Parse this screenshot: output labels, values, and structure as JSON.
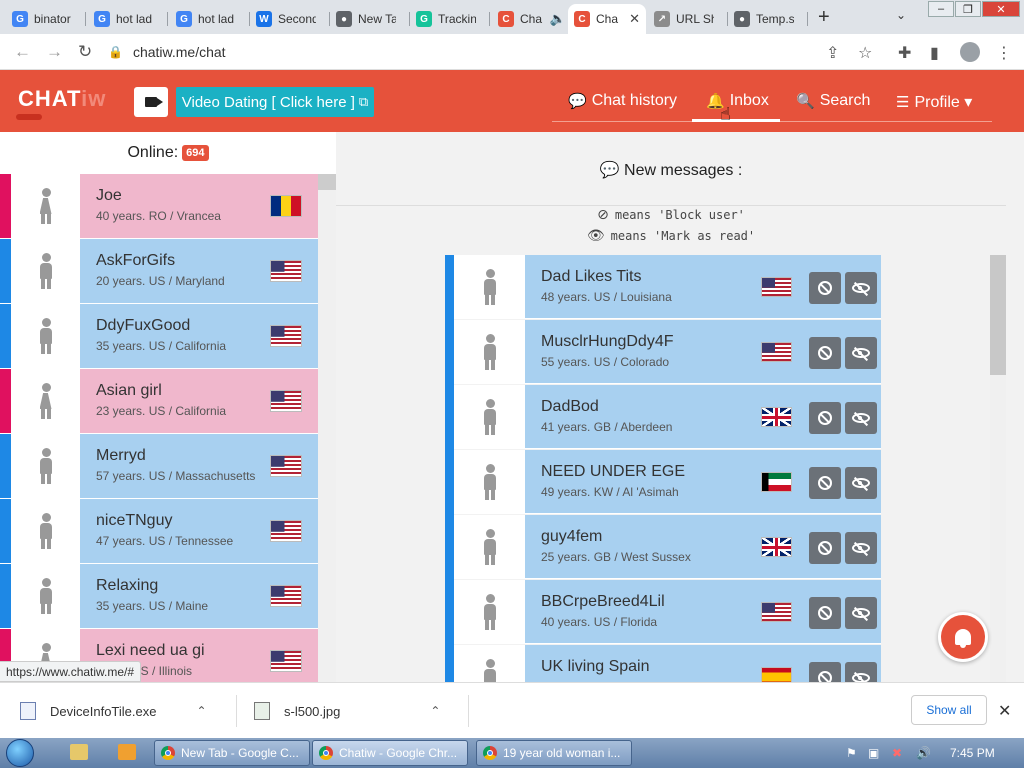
{
  "browser": {
    "tabs": [
      {
        "label": "binator",
        "favicon": "G",
        "color": "#4285f4",
        "active": false
      },
      {
        "label": "hot lad",
        "favicon": "G",
        "color": "#4285f4",
        "active": false
      },
      {
        "label": "hot lad",
        "favicon": "G",
        "color": "#4285f4",
        "active": false
      },
      {
        "label": "Second",
        "favicon": "W",
        "color": "#1a73e8",
        "active": false
      },
      {
        "label": "New Ta",
        "favicon": "●",
        "color": "#5f6368",
        "active": false
      },
      {
        "label": "Trackin",
        "favicon": "G",
        "color": "#15c39a",
        "active": false
      },
      {
        "label": "Cha",
        "favicon": "C",
        "color": "#e6523b",
        "active": false,
        "audio": "🔈"
      },
      {
        "label": "Cha",
        "favicon": "C",
        "color": "#e6523b",
        "active": true,
        "close": "✕"
      },
      {
        "label": "URL Sh",
        "favicon": "↗",
        "color": "#8c8c8c",
        "active": false
      },
      {
        "label": "Temp.s",
        "favicon": "●",
        "color": "#5f6368",
        "active": false
      }
    ],
    "new_tab": "+",
    "tab_menu": "⌄",
    "window_controls": [
      "–",
      "❐",
      "✕"
    ],
    "nav": {
      "back": "←",
      "forward": "→",
      "reload": "↻"
    },
    "lock_icon": "🔒",
    "url": "chatiw.me/chat",
    "toolbar_icons": {
      "share": "⇪",
      "star": "☆",
      "extensions": "✚",
      "sidepanel": "▮",
      "menu": "⋮"
    }
  },
  "header": {
    "logo_main": "CHAT",
    "logo_suffix": "iw",
    "video_dating_label": "Video Dating [ Click here ]",
    "external_icon": "⧉",
    "nav": [
      {
        "icon": "💬",
        "label": "Chat history"
      },
      {
        "icon": "🔔",
        "label": "Inbox"
      },
      {
        "icon": "🔍",
        "label": "Search"
      },
      {
        "icon": "☰",
        "label": "Profile ▾"
      }
    ],
    "cursor": "☝"
  },
  "online": {
    "label": "Online:",
    "count": "694",
    "users": [
      {
        "name": "Joe",
        "details": "40 years. RO / Vrancea",
        "gender": "female",
        "stripe": "#e0115f",
        "bg": "#f0b7cc",
        "flag": "ro"
      },
      {
        "name": "AskForGifs",
        "details": "20 years. US / Maryland",
        "gender": "male",
        "stripe": "#1e88e5",
        "bg": "#a8d0f0",
        "flag": "us"
      },
      {
        "name": "DdyFuxGood",
        "details": "35 years. US / California",
        "gender": "male",
        "stripe": "#1e88e5",
        "bg": "#a8d0f0",
        "flag": "us"
      },
      {
        "name": "Asian girl",
        "details": "23 years. US / California",
        "gender": "female",
        "stripe": "#e0115f",
        "bg": "#f0b7cc",
        "flag": "us"
      },
      {
        "name": "Merryd",
        "details": "57 years. US / Massachusetts",
        "gender": "male",
        "stripe": "#1e88e5",
        "bg": "#a8d0f0",
        "flag": "us"
      },
      {
        "name": "niceTNguy",
        "details": "47 years. US / Tennessee",
        "gender": "male",
        "stripe": "#1e88e5",
        "bg": "#a8d0f0",
        "flag": "us"
      },
      {
        "name": "Relaxing",
        "details": "35 years. US / Maine",
        "gender": "male",
        "stripe": "#1e88e5",
        "bg": "#a8d0f0",
        "flag": "us"
      },
      {
        "name": "Lexi need ua gi",
        "details": "years. US / Illinois",
        "gender": "female",
        "stripe": "#e0115f",
        "bg": "#f0b7cc",
        "flag": "us"
      }
    ]
  },
  "inbox": {
    "heading_icon": "💬",
    "heading": "New messages :",
    "legend_block_icon": "⊘",
    "legend_block": "means 'Block user'",
    "legend_read_icon": "👁",
    "legend_read": "means 'Mark as read'",
    "messages": [
      {
        "name": "Dad Likes Tits",
        "details": "48 years. US / Louisiana",
        "flag": "us"
      },
      {
        "name": "MusclrHungDdy4F",
        "details": "55 years. US / Colorado",
        "flag": "us"
      },
      {
        "name": "DadBod",
        "details": "41 years. GB / Aberdeen",
        "flag": "gb"
      },
      {
        "name": "NEED UNDER EGE",
        "details": "49 years. KW / Al 'Asimah",
        "flag": "kw"
      },
      {
        "name": "guy4fem",
        "details": "25 years. GB / West Sussex",
        "flag": "gb"
      },
      {
        "name": "BBCrpeBreed4Lil",
        "details": "40 years. US / Florida",
        "flag": "us"
      },
      {
        "name": "UK living Spain",
        "details": "",
        "flag": "es"
      }
    ]
  },
  "status_url": "https://www.chatiw.me/#",
  "downloads": {
    "items": [
      {
        "name": "DeviceInfoTile.exe",
        "chevron": "⌃"
      },
      {
        "name": "s-l500.jpg",
        "chevron": "⌃"
      }
    ],
    "show_all": "Show all",
    "close": "✕"
  },
  "taskbar": {
    "buttons": [
      {
        "label": "New Tab - Google C...",
        "active": false
      },
      {
        "label": "Chatiw - Google Chr...",
        "active": true
      },
      {
        "label": "19 year old woman i...",
        "active": false
      }
    ],
    "clock": "7:45 PM"
  }
}
